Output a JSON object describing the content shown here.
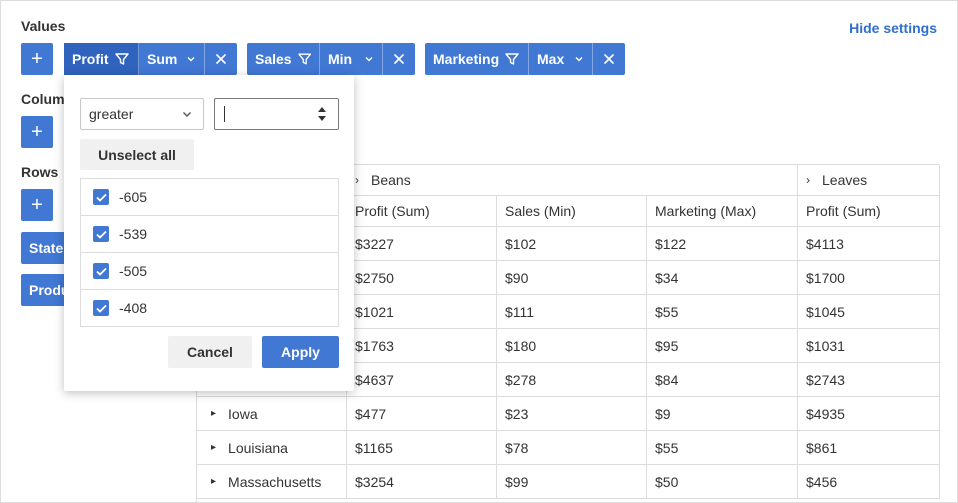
{
  "settings": {
    "values_label": "Values",
    "columns_label": "Columns",
    "rows_label": "Rows",
    "hide_settings": "Hide settings",
    "add_symbol": "+"
  },
  "value_chips": [
    {
      "field": "Profit",
      "op": "Sum"
    },
    {
      "field": "Sales",
      "op": "Min"
    },
    {
      "field": "Marketing",
      "op": "Max"
    }
  ],
  "row_chips": [
    "State",
    "Product"
  ],
  "filter_popup": {
    "condition": "greater",
    "value": "",
    "unselect_all": "Unselect all",
    "items": [
      "-605",
      "-539",
      "-505",
      "-408"
    ],
    "cancel": "Cancel",
    "apply": "Apply"
  },
  "table": {
    "groups": [
      "Beans",
      "Leaves"
    ],
    "headers": [
      "Profit (Sum)",
      "Sales (Min)",
      "Marketing (Max)",
      "Profit (Sum)"
    ],
    "rows": [
      {
        "state": "",
        "cells": [
          "$3227",
          "$102",
          "$122",
          "$4113"
        ]
      },
      {
        "state": "",
        "cells": [
          "$2750",
          "$90",
          "$34",
          "$1700"
        ]
      },
      {
        "state": "",
        "cells": [
          "$1021",
          "$111",
          "$55",
          "$1045"
        ]
      },
      {
        "state": "",
        "cells": [
          "$1763",
          "$180",
          "$95",
          "$1031"
        ]
      },
      {
        "state": "",
        "cells": [
          "$4637",
          "$278",
          "$84",
          "$2743"
        ]
      },
      {
        "state": "Iowa",
        "cells": [
          "$477",
          "$23",
          "$9",
          "$4935"
        ]
      },
      {
        "state": "Louisiana",
        "cells": [
          "$1165",
          "$78",
          "$55",
          "$861"
        ]
      },
      {
        "state": "Massachusetts",
        "cells": [
          "$3254",
          "$99",
          "$50",
          "$456"
        ]
      }
    ]
  },
  "colors": {
    "accent": "#4178d4",
    "accent_dark": "#2f63bd",
    "link": "#2f6fd0"
  }
}
